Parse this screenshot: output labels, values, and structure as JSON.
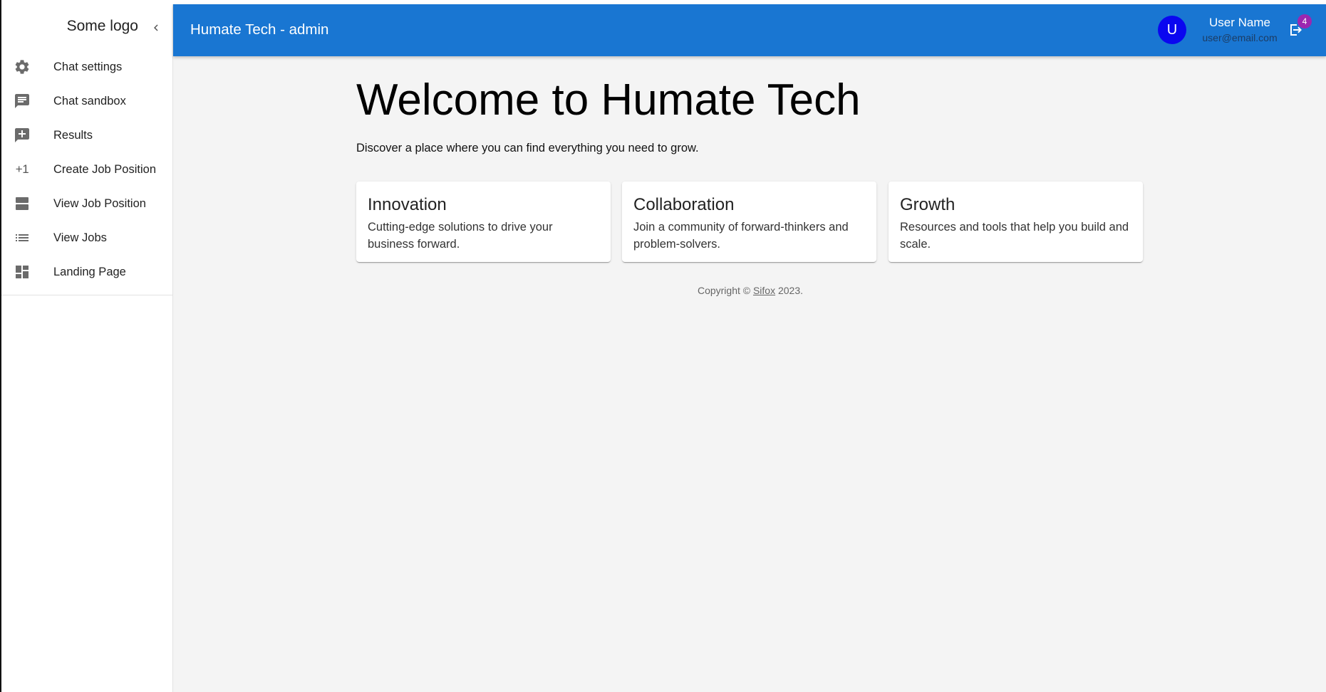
{
  "sidebar": {
    "logo": "Some logo",
    "collapse_icon": "chevron-left-icon",
    "items": [
      {
        "label": "Chat settings",
        "icon": "gear-icon"
      },
      {
        "label": "Chat sandbox",
        "icon": "chat-icon"
      },
      {
        "label": "Results",
        "icon": "add-comment-icon"
      },
      {
        "label": "Create Job Position",
        "icon": "plus-one-icon",
        "glyph": "+1"
      },
      {
        "label": "View Job Position",
        "icon": "view-agenda-icon"
      },
      {
        "label": "View Jobs",
        "icon": "list-icon"
      },
      {
        "label": "Landing Page",
        "icon": "dashboard-icon"
      }
    ]
  },
  "header": {
    "title": "Humate Tech - admin",
    "avatar_initial": "U",
    "user_name": "User Name",
    "user_email": "user@email.com",
    "notification_count": "4",
    "logout_icon": "logout-icon"
  },
  "main": {
    "title": "Welcome to Humate Tech",
    "subtitle": "Discover a place where you can find everything you need to grow.",
    "cards": [
      {
        "title": "Innovation",
        "text": "Cutting-edge solutions to drive your business forward."
      },
      {
        "title": "Collaboration",
        "text": "Join a community of forward-thinkers and problem-solvers."
      },
      {
        "title": "Growth",
        "text": "Resources and tools that help you build and scale."
      }
    ],
    "footer": {
      "prefix": "Copyright ©",
      "link": "Sifox",
      "suffix": "2023."
    }
  },
  "colors": {
    "app_bar": "#1976d2",
    "avatar": "#0a06f0",
    "badge": "#9c27b0",
    "background": "#f4f4f4"
  }
}
